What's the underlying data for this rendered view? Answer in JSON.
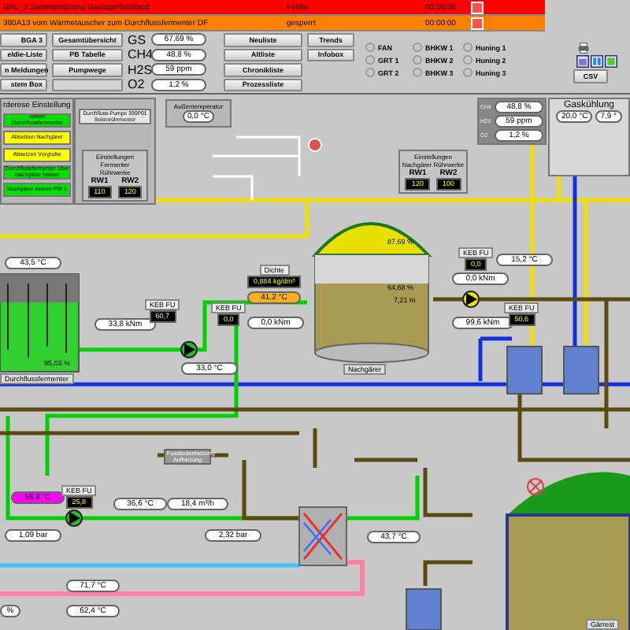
{
  "alarms": [
    {
      "text": "GRL_2 Sammelstörung Gaslagerfüllstand",
      "status": "Fehler",
      "time": "00:00:00",
      "color": "#ff0000"
    },
    {
      "text": "380A13 vom Wärmetauscher zum Durchflussfermenter DF",
      "status": "gesperrt",
      "time": "00:00:00",
      "color": "#ff8000"
    }
  ],
  "nav_buttons": [
    {
      "label": "BGA 3"
    },
    {
      "label": "eldie-Liste"
    },
    {
      "label": "n Meldungen"
    },
    {
      "label": "stem Box"
    }
  ],
  "overview_buttons": [
    {
      "label": "Gesamtübersicht"
    },
    {
      "label": "PB Tabelle"
    },
    {
      "label": "Pumpwege"
    },
    {
      "kind": "blank"
    }
  ],
  "gas_values": [
    {
      "name": "GS",
      "value": "67,69 %"
    },
    {
      "name": "CH4",
      "value": "48,8 %"
    },
    {
      "name": "H2S",
      "value": "59 ppm"
    },
    {
      "name": "O2",
      "value": "1,2 %"
    }
  ],
  "list_buttons": [
    {
      "label": "Neuliste"
    },
    {
      "label": "Altliste"
    },
    {
      "label": "Chronikliste"
    },
    {
      "label": "Prozessliste"
    }
  ],
  "extra_buttons": [
    {
      "label": "Trends"
    },
    {
      "label": "Infobox"
    }
  ],
  "radios": [
    {
      "label": "FAN",
      "selected": false
    },
    {
      "label": "GRT 1",
      "selected": false
    },
    {
      "label": "GRT 2",
      "selected": false
    },
    {
      "label": "BHKW 1",
      "selected": false
    },
    {
      "label": "BHKW 2",
      "selected": false
    },
    {
      "label": "BHKW 3",
      "selected": false
    },
    {
      "label": "Huning 1",
      "selected": false
    },
    {
      "label": "Huning 2",
      "selected": false
    },
    {
      "label": "Huning 3",
      "selected": false
    }
  ],
  "csv_button": "CSV",
  "mode_panel": {
    "title": "rderese Einstellung",
    "items": [
      {
        "label": "amten Durchflussfermenter",
        "color": "#00e000"
      },
      {
        "label": "Absetzen Nachgärer",
        "color": "#ffff00"
      },
      {
        "label": "Absetzen Vorgrube",
        "color": "#ffff00"
      },
      {
        "label": "Durchflussfermenter über Nachgärer heizen",
        "color": "#00e000"
      },
      {
        "label": "Nachgärer heizen PW 1",
        "color": "#00e000"
      }
    ]
  },
  "pump_button": "Durchfluss-Pumpe 330P01 Seitenrührmenter",
  "fermenter_agitators": {
    "title": "Einstellungen Fermenter Rührwerke",
    "items": [
      {
        "name": "RW1",
        "value": "110"
      },
      {
        "name": "RW2",
        "value": "120"
      }
    ]
  },
  "outdoor_temp": {
    "label": "Außentemperatur",
    "value": "0,0 °C"
  },
  "post_agitators": {
    "title": "Einstellungen Nachgärer Rührwerke",
    "items": [
      {
        "name": "RW1",
        "value": "120"
      },
      {
        "name": "RW2",
        "value": "100"
      }
    ]
  },
  "gas_panel": [
    {
      "name": "CH4",
      "value": "48,8 %"
    },
    {
      "name": "H2S",
      "value": "59 ppm"
    },
    {
      "name": "O2",
      "value": "1,2 %"
    }
  ],
  "gas_cooling": {
    "title": "Gaskühlung",
    "values": [
      "20,0 °C",
      "7,9 °"
    ]
  },
  "readings": [
    {
      "text": "43,5 °C"
    },
    {
      "text": "33,8 kNm"
    },
    {
      "text": "33,0 °C"
    },
    {
      "text": "0,0 kNm"
    },
    {
      "text": "41,2 °C",
      "color": "#ffb020"
    },
    {
      "text": "15,2 °C"
    },
    {
      "text": "0,0 kNm"
    },
    {
      "text": "99,6 kNm"
    },
    {
      "text": "58,8 °C",
      "color": "#ff00ff"
    },
    {
      "text": "36,6 °C"
    },
    {
      "text": "18,4 m³/h"
    },
    {
      "text": "1,09 bar"
    },
    {
      "text": "2,32 bar"
    },
    {
      "text": "43,7 °C"
    },
    {
      "text": "71,7 °C"
    },
    {
      "text": "62,4 °C"
    },
    {
      "text": "%"
    }
  ],
  "density": {
    "label": "Dichte",
    "value": "0,884 kg/dm³"
  },
  "drives": [
    {
      "label": "KEB FU",
      "value": "60,7"
    },
    {
      "label": "KEB FU",
      "value": "0,0"
    },
    {
      "label": "KEB FU",
      "value": "0,0"
    },
    {
      "label": "KEB FU",
      "value": "50,6"
    },
    {
      "label": "KEB FU",
      "value": "25,8"
    }
  ],
  "fermenter": {
    "fill": "95,03 %",
    "name": "Durchflussfermenter"
  },
  "post_digester": {
    "gas": "87,69 %",
    "fill": "64,68 %",
    "height": "7,21 m",
    "name": "Nachgärer"
  },
  "floor_heating": "Fussbodenheizung Aufheizung",
  "storage_name": "Gärrest"
}
